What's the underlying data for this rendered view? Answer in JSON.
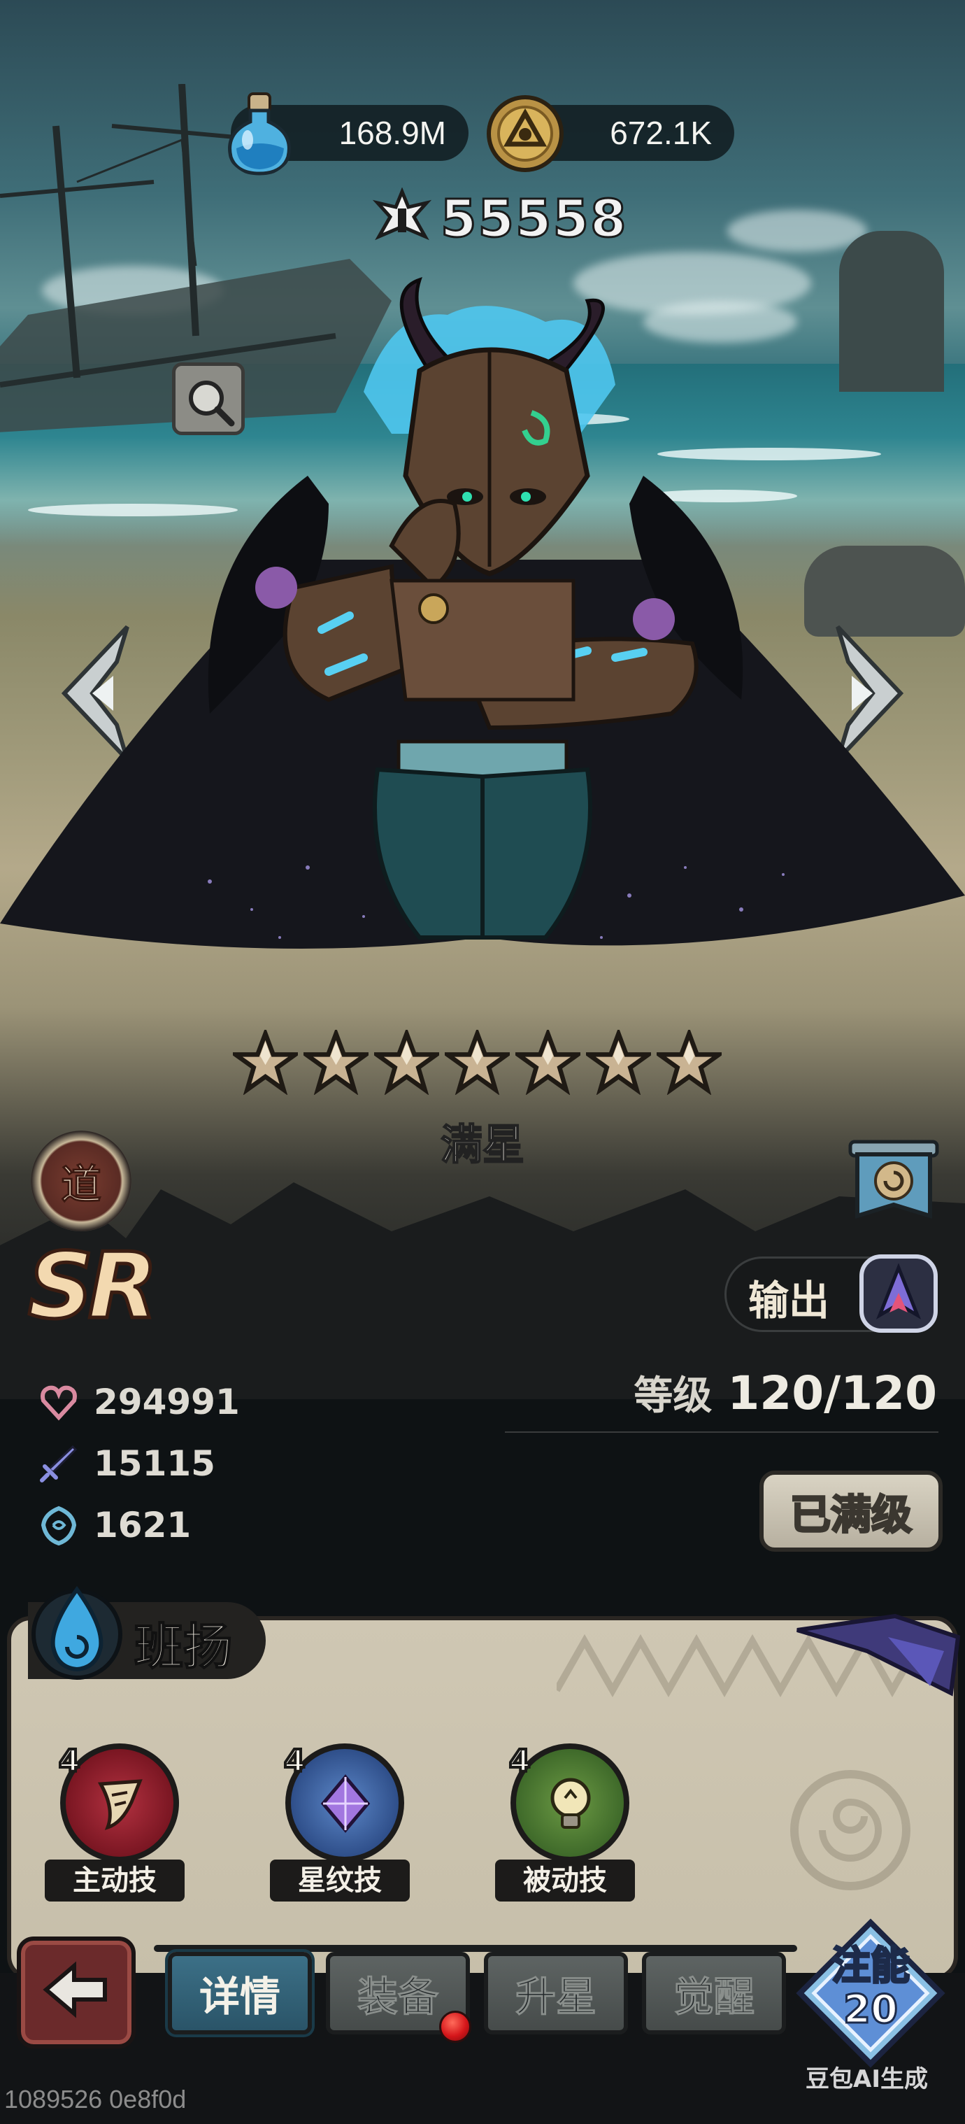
{
  "currency": {
    "potion": {
      "value": "168.9M",
      "icon": "blue-potion-icon"
    },
    "coin": {
      "value": "672.1K",
      "icon": "gold-coin-icon"
    }
  },
  "combat_power": {
    "value": "55558",
    "icon": "power-icon"
  },
  "hero": {
    "stars_count": 7,
    "star_label": "满星",
    "path_badge": "道",
    "rarity": "SR",
    "role": "输出",
    "level_label": "等级",
    "level_value": "120/120",
    "max_level_button": "已满级",
    "stats": [
      {
        "icon": "heart-hp-icon",
        "value": "294991"
      },
      {
        "icon": "sword-attack-icon",
        "value": "15115"
      },
      {
        "icon": "shield-defense-icon",
        "value": "1621"
      }
    ]
  },
  "faction": {
    "name": "班扬",
    "icon": "water-drop-icon"
  },
  "skills": [
    {
      "level": "4",
      "label": "主动技",
      "icon": "claw-icon",
      "color": "#8a1c26"
    },
    {
      "level": "4",
      "label": "星纹技",
      "icon": "crystal-icon",
      "color": "#2f4f8a"
    },
    {
      "level": "4",
      "label": "被动技",
      "icon": "lightbulb-icon",
      "color": "#3f6a2a"
    }
  ],
  "tabs": [
    {
      "label": "详情",
      "active": true
    },
    {
      "label": "装备",
      "active": false
    },
    {
      "label": "升星",
      "active": false
    },
    {
      "label": "觉醒",
      "active": false
    }
  ],
  "infuse": {
    "label": "注能",
    "count": "20"
  },
  "watermark": "豆包AI生成",
  "build_id": "1089526 0e8f0d",
  "colors": {
    "accent_blue": "#3c7087",
    "panel": "#cfc7b3",
    "dark": "#121416",
    "alert_red": "#d5161a"
  }
}
